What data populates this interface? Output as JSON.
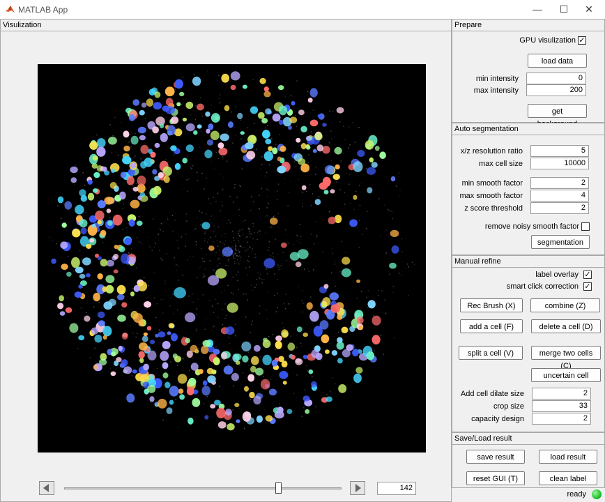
{
  "window": {
    "title": "MATLAB App",
    "minimize": "—",
    "maximize": "☐",
    "close": "✕"
  },
  "visualization": {
    "title": "Visulization"
  },
  "frame": {
    "value": "142",
    "slider_fraction": 0.78
  },
  "prepare": {
    "title": "Prepare",
    "gpu_label": "GPU visulization",
    "gpu_checked": true,
    "load_data": "load data",
    "min_intensity_label": "min intensity",
    "min_intensity": "0",
    "max_intensity_label": "max intensity",
    "max_intensity": "200",
    "get_background": "get background"
  },
  "auto": {
    "title": "Auto segmentation",
    "xz_label": "x/z resolution ratio",
    "xz": "5",
    "max_cell_label": "max cell size",
    "max_cell": "10000",
    "min_smooth_label": "min smooth factor",
    "min_smooth": "2",
    "max_smooth_label": "max smooth factor",
    "max_smooth": "4",
    "zscore_label": "z score threshold",
    "zscore": "2",
    "remove_noisy_label": "remove noisy smooth factor",
    "remove_noisy_checked": false,
    "segmentation": "segmentation"
  },
  "manual": {
    "title": "Manual refine",
    "label_overlay": "label overlay",
    "label_overlay_checked": true,
    "smart_click": "smart click correction",
    "smart_click_checked": true,
    "rec_brush": "Rec Brush (X)",
    "combine": "combine (Z)",
    "add_cell": "add a cell (F)",
    "delete_cell": "delete a cell (D)",
    "split_cell": "split a cell (V)",
    "merge_cells": "merge two cells (C)",
    "uncertain": "uncertain cell",
    "dilate_label": "Add cell dilate size",
    "dilate": "2",
    "crop_label": "crop size",
    "crop": "33",
    "capacity_label": "capacity design",
    "capacity": "2"
  },
  "saveload": {
    "title": "Save/Load result",
    "save": "save result",
    "load": "load result",
    "reset": "reset GUI (T)",
    "clean": "clean label"
  },
  "status": {
    "text": "ready",
    "color": "#22c32e"
  },
  "colors": {
    "palette": [
      "#3d5cff",
      "#5b7bff",
      "#45d6ff",
      "#69f0c8",
      "#ffe14d",
      "#ffb347",
      "#ff6b6b",
      "#c9f26b",
      "#7fd4ff",
      "#b9a7ff",
      "#ffd1e8",
      "#a0ffa0"
    ]
  }
}
